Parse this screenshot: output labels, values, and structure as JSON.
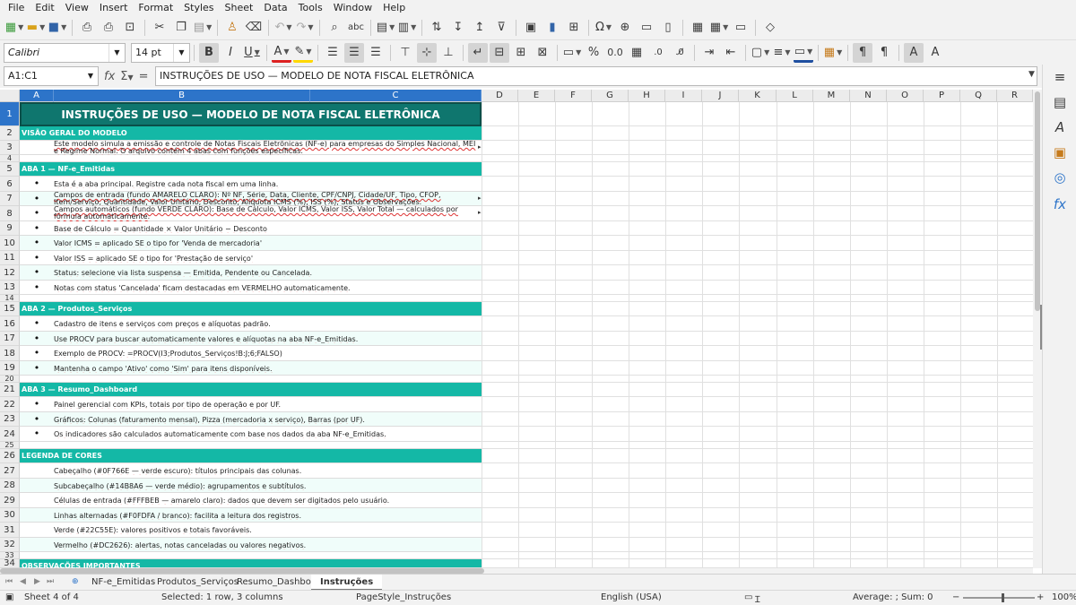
{
  "menu": [
    "File",
    "Edit",
    "View",
    "Insert",
    "Format",
    "Styles",
    "Sheet",
    "Data",
    "Tools",
    "Window",
    "Help"
  ],
  "format_toolbar": {
    "font_name": "Calibri",
    "font_size": "14 pt"
  },
  "formula_bar": {
    "cell_ref": "A1:C1",
    "content": "INSTRUÇÕES DE USO — MODELO DE NOTA FISCAL ELETRÔNICA"
  },
  "columns": [
    "A",
    "B",
    "C",
    "D",
    "E",
    "F",
    "G",
    "H",
    "I",
    "J",
    "K",
    "L",
    "M",
    "N",
    "O",
    "P",
    "Q",
    "R"
  ],
  "rows": {
    "r1": {
      "num": "1",
      "text": "INSTRUÇÕES DE USO — MODELO DE NOTA FISCAL ELETRÔNICA"
    },
    "r2": {
      "num": "2",
      "text": "VISÃO GERAL DO MODELO"
    },
    "r3": {
      "num": "3",
      "text": "Este modelo simula a emissão e controle de Notas Fiscais Eletrônicas (NF-e) para empresas do Simples Nacional, MEI e Regime Normal. O arquivo contém 4 abas com funções específicas."
    },
    "r4": {
      "num": "4"
    },
    "r5": {
      "num": "5",
      "text": "ABA 1 — NF-e_Emitidas"
    },
    "r6": {
      "num": "6",
      "text": "Esta é a aba principal. Registre cada nota fiscal em uma linha."
    },
    "r7": {
      "num": "7",
      "text": "Campos de entrada (fundo AMARELO CLARO): Nº NF, Série, Data, Cliente, CPF/CNPJ, Cidade/UF, Tipo, CFOP, Item/Serviço, Quantidade, Valor Unitário, Desconto, Alíquota ICMS (%), ISS (%), Status e Observações."
    },
    "r8": {
      "num": "8",
      "text": "Campos automáticos (fundo VERDE CLARO): Base de Cálculo, Valor ICMS, Valor ISS, Valor Total — calculados por fórmula automaticamente."
    },
    "r9": {
      "num": "9",
      "text": "Base de Cálculo = Quantidade × Valor Unitário − Desconto"
    },
    "r10": {
      "num": "10",
      "text": "Valor ICMS = aplicado SE o tipo for 'Venda de mercadoria'"
    },
    "r11": {
      "num": "11",
      "text": "Valor ISS = aplicado SE o tipo for 'Prestação de serviço'"
    },
    "r12": {
      "num": "12",
      "text": "Status: selecione via lista suspensa — Emitida, Pendente ou Cancelada."
    },
    "r13": {
      "num": "13",
      "text": "Notas com status 'Cancelada' ficam destacadas em VERMELHO automaticamente."
    },
    "r14": {
      "num": "14"
    },
    "r15": {
      "num": "15",
      "text": "ABA 2 — Produtos_Serviços"
    },
    "r16": {
      "num": "16",
      "text": "Cadastro de itens e serviços com preços e alíquotas padrão."
    },
    "r17": {
      "num": "17",
      "text": "Use PROCV para buscar automaticamente valores e alíquotas na aba NF-e_Emitidas."
    },
    "r18": {
      "num": "18",
      "text": "Exemplo de PROCV: =PROCV(I3;Produtos_Serviços!B:J;6;FALSO)"
    },
    "r19": {
      "num": "19",
      "text": "Mantenha o campo 'Ativo' como 'Sim' para itens disponíveis."
    },
    "r20": {
      "num": "20"
    },
    "r21": {
      "num": "21",
      "text": "ABA 3 — Resumo_Dashboard"
    },
    "r22": {
      "num": "22",
      "text": "Painel gerencial com KPIs, totais por tipo de operação e por UF."
    },
    "r23": {
      "num": "23",
      "text": "Gráficos: Colunas (faturamento mensal), Pizza (mercadoria x serviço), Barras (por UF)."
    },
    "r24": {
      "num": "24",
      "text": "Os indicadores são calculados automaticamente com base nos dados da aba NF-e_Emitidas."
    },
    "r25": {
      "num": "25"
    },
    "r26": {
      "num": "26",
      "text": "LEGENDA DE CORES"
    },
    "r27": {
      "num": "27",
      "text": "Cabeçalho (#0F766E — verde escuro): títulos principais das colunas."
    },
    "r28": {
      "num": "28",
      "text": "Subcabeçalho (#14B8A6 — verde médio): agrupamentos e subtítulos."
    },
    "r29": {
      "num": "29",
      "text": "Células de entrada (#FFFBEB — amarelo claro): dados que devem ser digitados pelo usuário."
    },
    "r30": {
      "num": "30",
      "text": "Linhas alternadas (#F0FDFA / branco): facilita a leitura dos registros."
    },
    "r31": {
      "num": "31",
      "text": "Verde (#22C55E): valores positivos e totais favoráveis."
    },
    "r32": {
      "num": "32",
      "text": "Vermelho (#DC2626): alertas, notas canceladas ou valores negativos."
    },
    "r33": {
      "num": "33"
    },
    "r34": {
      "num": "34",
      "text": "OBSERVAÇÕES IMPORTANTES"
    }
  },
  "sheet_tabs": [
    "NF-e_Emitidas",
    "Produtos_Serviços",
    "Resumo_Dashboard",
    "Instruções"
  ],
  "active_tab": "Instruções",
  "status": {
    "sheet": "Sheet 4 of 4",
    "selection": "Selected: 1 row, 3 columns",
    "page_style": "PageStyle_Instruções",
    "language": "English (USA)",
    "summary": "Average: ; Sum: 0",
    "zoom": "100%"
  },
  "colors": {
    "header": "#0F766E",
    "subheader": "#14B8A6",
    "alt_row": "#F0FDFA",
    "selection": "#2D74C9"
  }
}
